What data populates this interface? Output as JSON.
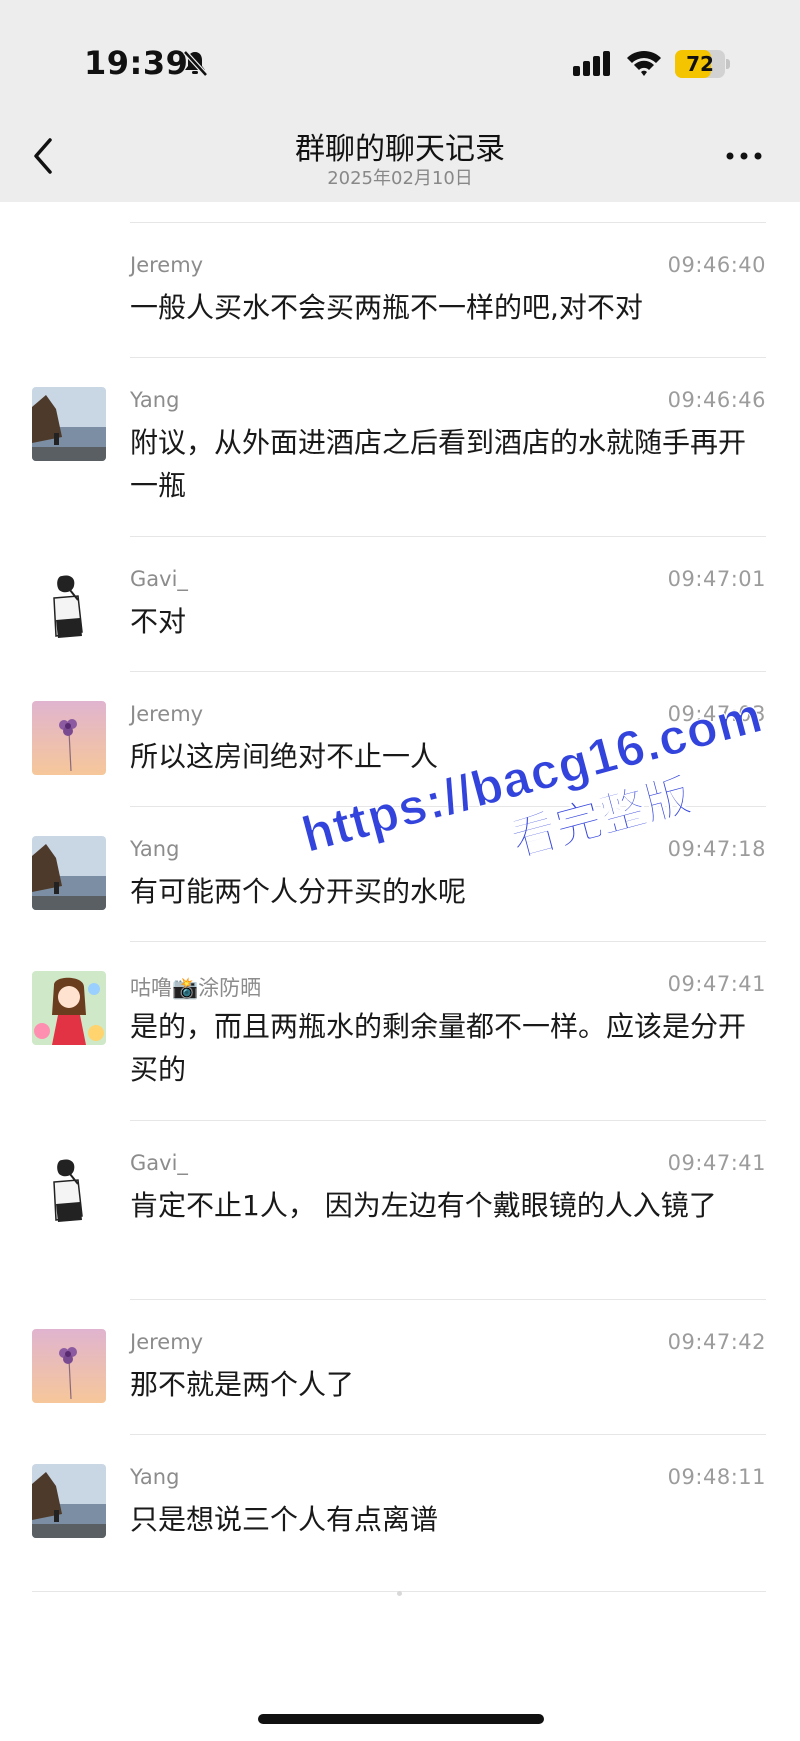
{
  "status_bar": {
    "time": "19:39",
    "battery": "72",
    "battery_fraction": 0.72,
    "icons": [
      "bell-muted-icon",
      "signal-icon",
      "wifi-icon",
      "battery-icon"
    ]
  },
  "header": {
    "title": "群聊的聊天记录",
    "subtitle": "2025年02月10日",
    "back_icon": "chevron-left-icon",
    "more_icon": "more-icon"
  },
  "messages": [
    {
      "sender": "Jeremy",
      "time": "09:46:40",
      "text": "一般人买水不会买两瓶不一样的吧,对不对",
      "avatar": "none"
    },
    {
      "sender": "Yang",
      "time": "09:46:46",
      "text": "附议，从外面进酒店之后看到酒店的水就随手再开一瓶",
      "avatar": "seaside-photo"
    },
    {
      "sender": "Gavi_",
      "time": "09:47:01",
      "text": "不对",
      "avatar": "sketch-man"
    },
    {
      "sender": "Jeremy",
      "time": "09:47:03",
      "text": "所以这房间绝对不止一人",
      "avatar": "flower-gradient"
    },
    {
      "sender": "Yang",
      "time": "09:47:18",
      "text": "有可能两个人分开买的水呢",
      "avatar": "seaside-photo"
    },
    {
      "sender": "咕噜📸涂防晒",
      "time": "09:47:41",
      "text": "是的，而且两瓶水的剩余量都不一样。应该是分开买的",
      "avatar": "cartoon-girl"
    },
    {
      "sender": "Gavi_",
      "time": "09:47:41",
      "text": "肯定不止1人， 因为左边有个戴眼镜的人入镜了",
      "avatar": "sketch-man"
    },
    {
      "sender": "Jeremy",
      "time": "09:47:42",
      "text": "那不就是两个人了",
      "avatar": "flower-gradient"
    },
    {
      "sender": "Yang",
      "time": "09:48:11",
      "text": "只是想说三个人有点离谱",
      "avatar": "seaside-photo"
    }
  ],
  "watermark": {
    "line1": "https://bacg16.com",
    "line2": "看完整版",
    "color": "#3344dd"
  }
}
